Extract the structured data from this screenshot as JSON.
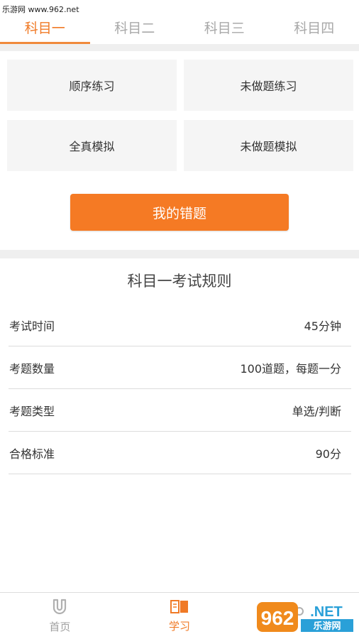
{
  "watermark": "乐游网 www.962.net",
  "tabs": [
    {
      "label": "科目一",
      "active": true
    },
    {
      "label": "科目二",
      "active": false
    },
    {
      "label": "科目三",
      "active": false
    },
    {
      "label": "科目四",
      "active": false
    }
  ],
  "practice": {
    "sequential": "顺序练习",
    "unanswered_practice": "未做题练习",
    "full_mock": "全真模拟",
    "unanswered_mock": "未做题模拟"
  },
  "wrong_button": "我的错题",
  "rules": {
    "title": "科目一考试规则",
    "rows": [
      {
        "key": "考试时间",
        "value": "45分钟"
      },
      {
        "key": "考题数量",
        "value": "100道题，每题一分"
      },
      {
        "key": "考题类型",
        "value": "单选/判断"
      },
      {
        "key": "合格标准",
        "value": "90分"
      }
    ]
  },
  "bottom_nav": {
    "home": {
      "label": "首页",
      "icon": "magnet-icon"
    },
    "study": {
      "label": "学习",
      "icon": "book-icon"
    }
  },
  "logo": {
    "text": "962",
    "sub": ".NET",
    "cn": "乐游网"
  },
  "colors": {
    "accent": "#f57a24",
    "inactive": "#a8a8a8"
  }
}
